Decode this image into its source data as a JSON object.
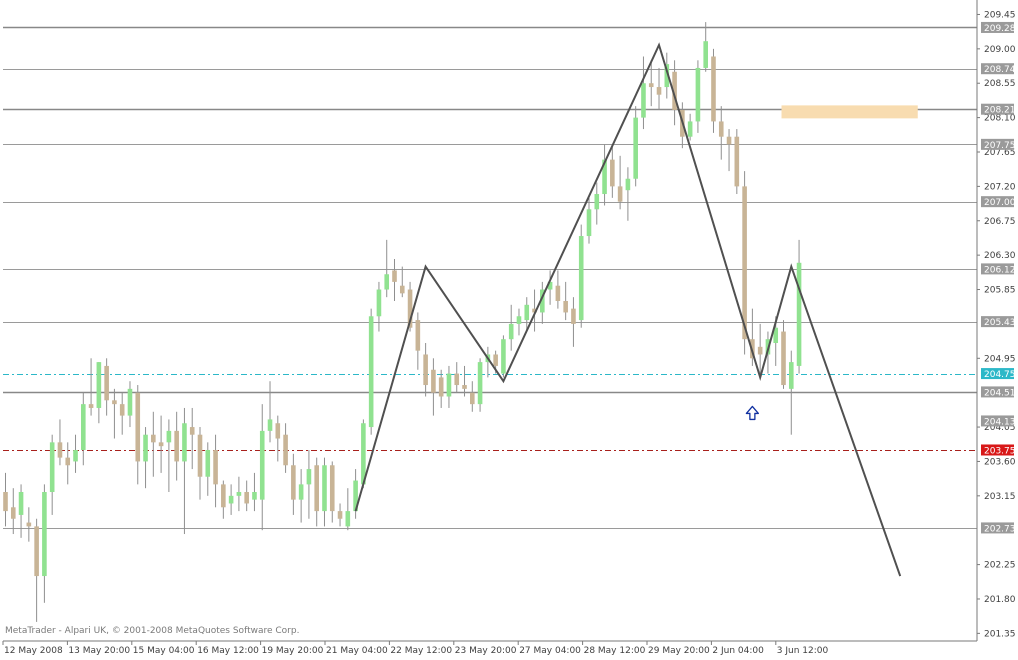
{
  "app": {
    "copyright": "MetaTrader - Alpari UK, © 2001-2008 MetaQuotes Software Corp."
  },
  "colors": {
    "bull_candle": "#90e290",
    "bear_candle": "#c8b496",
    "wick": "#8f8f8f",
    "zigzag": "#505050",
    "level_line": "#9a9a9a",
    "level_tag": "#9a9a9a",
    "cyan_line": "#2cb8c8",
    "red_line": "#a8201c",
    "red_tag": "#d81818",
    "zone_fill": "#f8dcb0",
    "arrow": "#1030a0",
    "axis": "#7a7a7a"
  },
  "chart_data": {
    "type": "candlestick",
    "symbol_timeframe": "",
    "ylim": [
      201.25,
      209.6
    ],
    "y_ticks": [
      209.45,
      209.0,
      208.55,
      208.1,
      207.65,
      207.2,
      206.75,
      206.3,
      205.85,
      204.95,
      204.05,
      203.6,
      203.15,
      202.25,
      201.8,
      201.35
    ],
    "x_ticks": [
      "12 May 2008",
      "13 May 20:00",
      "15 May 04:00",
      "16 May 12:00",
      "19 May 20:00",
      "21 May 04:00",
      "22 May 12:00",
      "23 May 20:00",
      "27 May 04:00",
      "28 May 12:00",
      "29 May 20:00",
      "2 Jun 04:00",
      "3 Jun 12:00"
    ],
    "horizontal_levels": [
      {
        "price": 209.28,
        "label": "209.28",
        "style": "solid-dark"
      },
      {
        "price": 208.74,
        "label": "208.74",
        "style": "solid"
      },
      {
        "price": 208.21,
        "label": "208.21",
        "style": "solid-dark"
      },
      {
        "price": 207.75,
        "label": "207.75",
        "style": "solid"
      },
      {
        "price": 207.0,
        "label": "207.00",
        "style": "solid"
      },
      {
        "price": 206.12,
        "label": "206.12",
        "style": "solid"
      },
      {
        "price": 205.43,
        "label": "205.43",
        "style": "solid"
      },
      {
        "price": 204.75,
        "label": "204.75",
        "style": "cyan-dashdot"
      },
      {
        "price": 204.51,
        "label": "204.51",
        "style": "solid-dark"
      },
      {
        "price": 204.13,
        "label": "204.13",
        "style": "tag-only"
      },
      {
        "price": 203.75,
        "label": "203.75",
        "style": "red-dashdot"
      },
      {
        "price": 202.73,
        "label": "202.73",
        "style": "solid"
      }
    ],
    "zone": {
      "price_top": 208.26,
      "price_bottom": 208.09,
      "bar_start": 100,
      "bar_end": 117
    },
    "zigzag": [
      {
        "bar": 45,
        "price": 202.95
      },
      {
        "bar": 54,
        "price": 206.15
      },
      {
        "bar": 64,
        "price": 204.65
      },
      {
        "bar": 84,
        "price": 209.05
      },
      {
        "bar": 97,
        "price": 204.7
      },
      {
        "bar": 101,
        "price": 206.15
      },
      {
        "bar": 115,
        "price": 202.1
      }
    ],
    "arrow_marker": {
      "bar": 96,
      "price": 204.32,
      "direction": "up"
    },
    "candles": [
      [
        203.2,
        203.45,
        202.75,
        202.95
      ],
      [
        203.0,
        203.25,
        202.65,
        202.85
      ],
      [
        202.9,
        203.3,
        202.6,
        203.2
      ],
      [
        202.8,
        203.0,
        202.55,
        202.75
      ],
      [
        202.75,
        202.85,
        201.5,
        202.1
      ],
      [
        202.1,
        203.3,
        201.75,
        203.2
      ],
      [
        203.2,
        203.95,
        202.9,
        203.85
      ],
      [
        203.85,
        204.15,
        203.55,
        203.65
      ],
      [
        203.65,
        203.85,
        203.3,
        203.55
      ],
      [
        203.6,
        203.95,
        203.45,
        203.75
      ],
      [
        203.75,
        204.5,
        203.55,
        204.35
      ],
      [
        204.35,
        204.95,
        204.2,
        204.3
      ],
      [
        204.3,
        204.9,
        204.1,
        204.9
      ],
      [
        204.85,
        204.95,
        204.2,
        204.4
      ],
      [
        204.4,
        204.55,
        203.9,
        204.35
      ],
      [
        204.35,
        204.5,
        203.95,
        204.2
      ],
      [
        204.2,
        204.65,
        204.05,
        204.55
      ],
      [
        204.5,
        204.6,
        203.3,
        203.6
      ],
      [
        203.6,
        204.05,
        203.25,
        203.95
      ],
      [
        203.95,
        204.25,
        203.4,
        203.85
      ],
      [
        203.85,
        204.2,
        203.45,
        203.8
      ],
      [
        203.85,
        204.15,
        203.2,
        204.0
      ],
      [
        204.0,
        204.25,
        203.35,
        203.6
      ],
      [
        203.6,
        204.3,
        202.65,
        204.1
      ],
      [
        204.05,
        204.3,
        203.5,
        203.95
      ],
      [
        203.95,
        204.05,
        203.1,
        203.4
      ],
      [
        203.4,
        203.85,
        203.15,
        203.75
      ],
      [
        203.75,
        203.95,
        203.0,
        203.3
      ],
      [
        203.3,
        203.35,
        202.85,
        203.0
      ],
      [
        203.05,
        203.3,
        202.9,
        203.15
      ],
      [
        203.15,
        203.4,
        202.95,
        203.2
      ],
      [
        203.2,
        203.35,
        202.95,
        203.05
      ],
      [
        203.1,
        203.45,
        202.95,
        203.2
      ],
      [
        203.1,
        204.35,
        202.7,
        204.0
      ],
      [
        204.0,
        204.65,
        203.85,
        204.15
      ],
      [
        204.1,
        204.2,
        203.6,
        203.9
      ],
      [
        203.95,
        204.1,
        203.45,
        203.55
      ],
      [
        203.55,
        203.7,
        202.9,
        203.1
      ],
      [
        203.1,
        203.5,
        202.8,
        203.3
      ],
      [
        203.3,
        203.75,
        202.85,
        203.5
      ],
      [
        203.55,
        203.65,
        202.75,
        202.95
      ],
      [
        202.95,
        203.65,
        202.75,
        203.55
      ],
      [
        203.55,
        203.6,
        202.8,
        202.95
      ],
      [
        202.95,
        203.05,
        202.75,
        202.85
      ],
      [
        202.75,
        203.25,
        202.7,
        202.95
      ],
      [
        202.95,
        203.5,
        202.85,
        203.35
      ],
      [
        203.3,
        204.15,
        203.25,
        204.1
      ],
      [
        204.05,
        205.6,
        203.95,
        205.5
      ],
      [
        205.5,
        205.95,
        205.3,
        205.85
      ],
      [
        205.85,
        206.5,
        205.75,
        206.05
      ],
      [
        206.1,
        206.25,
        205.7,
        205.95
      ],
      [
        205.9,
        206.15,
        205.75,
        205.8
      ],
      [
        205.85,
        205.95,
        205.3,
        205.35
      ],
      [
        205.45,
        205.55,
        204.8,
        205.05
      ],
      [
        205.0,
        205.15,
        204.45,
        204.6
      ],
      [
        204.8,
        204.95,
        204.2,
        204.5
      ],
      [
        204.7,
        204.8,
        204.3,
        204.45
      ],
      [
        204.45,
        204.85,
        204.3,
        204.75
      ],
      [
        204.75,
        204.9,
        204.5,
        204.6
      ],
      [
        204.6,
        204.85,
        204.45,
        204.55
      ],
      [
        204.5,
        204.65,
        204.25,
        204.35
      ],
      [
        204.35,
        204.95,
        204.25,
        204.9
      ],
      [
        204.9,
        205.1,
        204.7,
        205.0
      ],
      [
        205.0,
        205.05,
        204.75,
        204.85
      ],
      [
        204.75,
        205.25,
        204.7,
        205.2
      ],
      [
        205.2,
        205.65,
        205.05,
        205.4
      ],
      [
        205.4,
        205.6,
        205.25,
        205.5
      ],
      [
        205.45,
        205.75,
        205.3,
        205.65
      ],
      [
        205.6,
        205.85,
        205.3,
        205.55
      ],
      [
        205.55,
        205.95,
        205.4,
        205.85
      ],
      [
        205.85,
        206.1,
        205.65,
        205.95
      ],
      [
        205.9,
        206.1,
        205.6,
        205.7
      ],
      [
        205.7,
        205.95,
        205.45,
        205.55
      ],
      [
        205.6,
        205.75,
        205.1,
        205.4
      ],
      [
        205.45,
        206.7,
        205.35,
        206.55
      ],
      [
        206.55,
        207.05,
        206.45,
        206.9
      ],
      [
        206.9,
        207.25,
        206.7,
        207.1
      ],
      [
        207.1,
        207.75,
        206.95,
        207.55
      ],
      [
        207.55,
        207.75,
        207.05,
        207.2
      ],
      [
        207.2,
        207.6,
        206.9,
        207.0
      ],
      [
        207.15,
        207.45,
        206.75,
        207.3
      ],
      [
        207.3,
        208.25,
        207.2,
        208.1
      ],
      [
        208.1,
        208.9,
        207.95,
        208.55
      ],
      [
        208.55,
        208.85,
        208.25,
        208.5
      ],
      [
        208.5,
        208.75,
        208.2,
        208.4
      ],
      [
        208.5,
        208.95,
        208.35,
        208.8
      ],
      [
        208.7,
        208.85,
        208.0,
        208.2
      ],
      [
        208.2,
        208.3,
        207.7,
        207.85
      ],
      [
        207.85,
        208.15,
        207.8,
        208.05
      ],
      [
        208.05,
        208.85,
        207.9,
        208.75
      ],
      [
        208.75,
        209.35,
        208.7,
        209.1
      ],
      [
        208.9,
        209.0,
        207.9,
        208.05
      ],
      [
        208.05,
        208.25,
        207.55,
        207.85
      ],
      [
        207.85,
        207.95,
        207.4,
        207.75
      ],
      [
        207.85,
        207.95,
        207.1,
        207.2
      ],
      [
        207.2,
        207.4,
        205.0,
        205.2
      ],
      [
        205.2,
        205.6,
        204.85,
        204.95
      ],
      [
        205.1,
        205.4,
        204.7,
        205.0
      ],
      [
        205.0,
        205.3,
        204.75,
        205.2
      ],
      [
        205.15,
        205.5,
        204.85,
        205.35
      ],
      [
        205.3,
        205.45,
        204.55,
        204.6
      ],
      [
        204.55,
        205.05,
        203.95,
        204.9
      ],
      [
        204.85,
        206.5,
        204.75,
        206.2
      ]
    ]
  }
}
